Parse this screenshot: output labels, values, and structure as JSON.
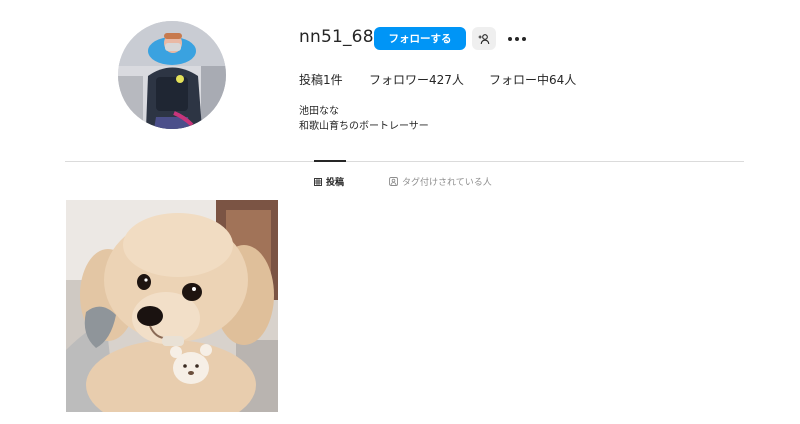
{
  "profile": {
    "username": "nn51_68",
    "follow_label": "フォローする",
    "stats": {
      "posts": "投稿1件",
      "followers": "フォロワー427人",
      "following": "フォロー中64人"
    },
    "bio_name": "池田なな",
    "bio_text": "和歌山育ちのボートレーサー"
  },
  "tabs": {
    "posts": "投稿",
    "tagged": "タグ付けされている人"
  },
  "icons": {
    "suggest": "person-plus-icon",
    "more": "more-dots-icon",
    "grid": "grid-icon",
    "tag": "tag-person-icon"
  },
  "colors": {
    "accent": "#0095f6",
    "divider": "#dbdbdb",
    "muted_text": "#8e8e8e"
  }
}
